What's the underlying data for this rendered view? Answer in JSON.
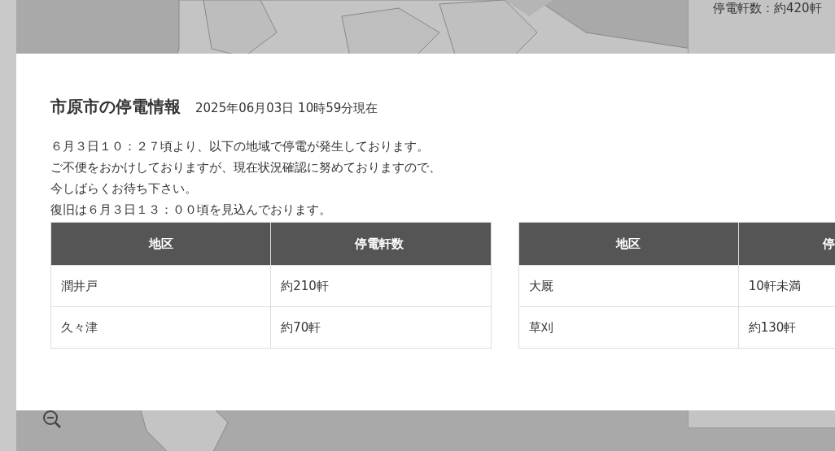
{
  "sidebar": {
    "outage_count": "停電軒数：約420軒"
  },
  "modal": {
    "title": "市原市の停電情報",
    "timestamp": "2025年06月03日 10時59分現在",
    "message": [
      "６月３日１０：２７頃より、以下の地域で停電が発生しております。",
      "ご不便をおかけしておりますが、現在状況確認に努めておりますので、",
      "今しばらくお待ち下さい。",
      "復旧は６月３日１３：００頃を見込んでおります。"
    ],
    "tables": [
      {
        "columns": [
          "地区",
          "停電軒数"
        ],
        "rows": [
          [
            "潤井戸",
            "約210軒"
          ],
          [
            "久々津",
            "約70軒"
          ]
        ]
      },
      {
        "columns": [
          "地区",
          "停"
        ],
        "rows": [
          [
            "大厩",
            "10軒未満"
          ],
          [
            "草刈",
            "約130軒"
          ]
        ]
      }
    ]
  }
}
